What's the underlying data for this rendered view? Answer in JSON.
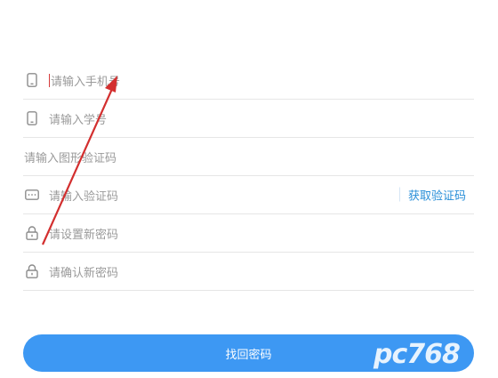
{
  "form": {
    "phone_placeholder": "请输入手机号",
    "account_placeholder": "请输入学号",
    "captcha_placeholder": "请输入图形验证码",
    "sms_code_placeholder": "请输入验证码",
    "get_code_label": "获取验证码",
    "new_password_placeholder": "请设置新密码",
    "confirm_password_placeholder": "请确认新密码"
  },
  "submit_label": "找回密码",
  "watermark_text": "pc768",
  "colors": {
    "accent": "#3d98f3",
    "link": "#2a8fd8",
    "arrow": "#d32f2f",
    "divider": "#e6e6e6",
    "placeholder": "#9a9a9a"
  },
  "icons": {
    "phone": "phone-icon",
    "account": "phone-icon",
    "sms": "message-icon",
    "password": "lock-icon"
  }
}
